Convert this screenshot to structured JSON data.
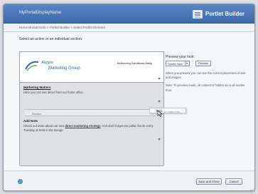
{
  "window": {
    "app_title": "MyPortalDisplayName",
    "product_title": "Portlet Builder",
    "product_icon": "portlet-builder-icon"
  },
  "breadcrumb": "Home Breadcrumb > Portlet Builder > Select Portlet Element",
  "instruction": "Select an action or an individual section.",
  "preview": {
    "logo_line1": "Aspyre",
    "logo_line2": "Marketing Group",
    "logo_slogan": "Delivering Solutions Daily",
    "section1_heading": "Marketing Matters",
    "section1_text": "Here you can see direct from our home office.",
    "selected_strip_label": "Section",
    "section2_heading": "Add Note",
    "section2_text_a": "Check out more about our new ",
    "section2_link": "direct marketing strategy",
    "section2_text_b": ". And don't forget our public forum every Tuesday at 9AM in the lounge."
  },
  "edit_popup": {
    "label": "Edit",
    "sub": "to make this"
  },
  "side": {
    "preview_label": "Preview your look:",
    "select_value": "Select Style",
    "preview_button": "Preview",
    "note1": "When you preview you can see the correct placement of text and images.",
    "note2": "Note: To preview mode, all content is hidden as in all modes thus."
  },
  "footer": {
    "help_icon": "help-icon",
    "save_button": "Save and Close",
    "cancel_button": "Cancel"
  },
  "colors": {
    "titlebar": "#4a76b8",
    "accent": "#3566a8"
  }
}
